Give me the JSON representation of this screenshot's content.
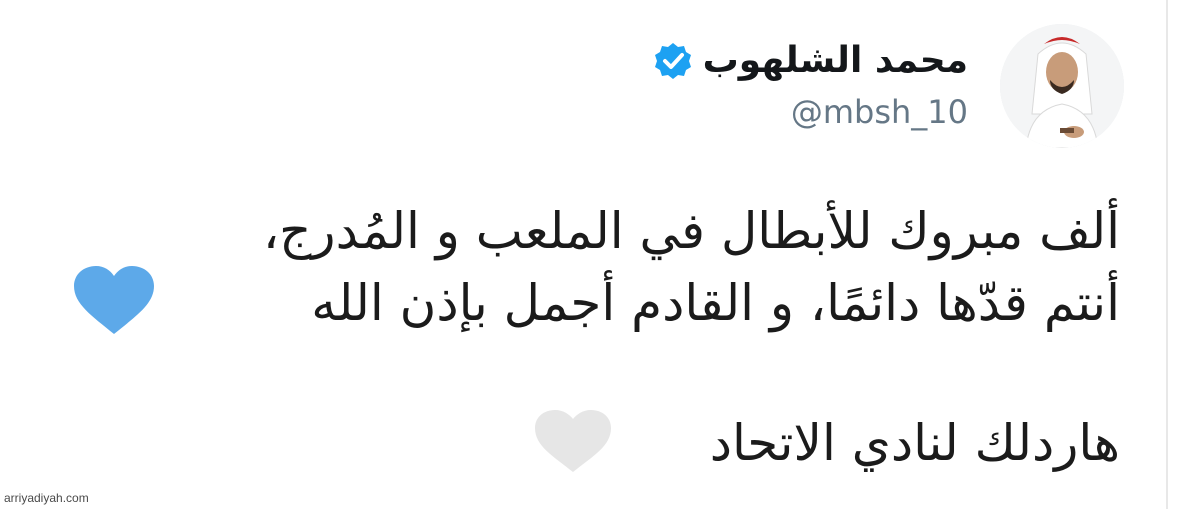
{
  "tweet": {
    "display_name": "محمد الشلهوب",
    "handle": "@mbsh_10",
    "verified": true,
    "lines": [
      "ألف مبروك للأبطال في الملعب و المُدرج،",
      "أنتم قدّها دائمًا، و القادم أجمل بإذن الله",
      "هاردلك لنادي الاتحاد"
    ],
    "emoji": {
      "line2_emoji": "blue-heart-icon",
      "line3_emoji": "white-heart-icon"
    }
  },
  "watermark": "arriyadiyah.com",
  "colors": {
    "verified_blue": "#1da1f2",
    "blue_heart": "#5da9e9",
    "white_heart": "#e6e6e6",
    "text": "#14171a",
    "handle": "#657786"
  }
}
